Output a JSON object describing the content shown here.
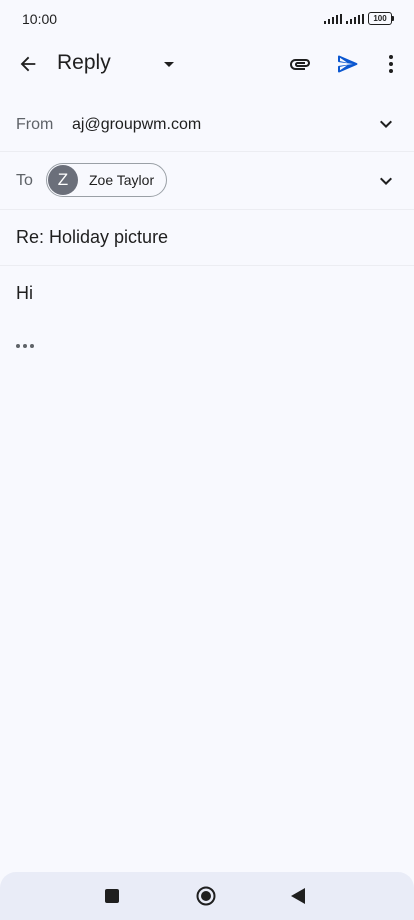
{
  "status_bar": {
    "time": "10:00",
    "battery": "100"
  },
  "app_bar": {
    "title": "Reply",
    "icons": {
      "back": "arrow-back-icon",
      "dropdown": "caret-down-icon",
      "attach": "paperclip-icon",
      "send": "send-icon",
      "more": "more-vert-icon"
    }
  },
  "compose": {
    "from_label": "From",
    "from_value": "aj@groupwm.com",
    "to_label": "To",
    "recipient": {
      "initial": "Z",
      "name": "Zoe Taylor"
    },
    "subject": "Re: Holiday picture",
    "body": "Hi"
  },
  "nav_bar": {
    "icons": [
      "square-recents-icon",
      "circle-home-icon",
      "triangle-back-icon"
    ]
  },
  "colors": {
    "background": "#f8f9fe",
    "send_accent": "#0b57d0",
    "chip_avatar": "#6b6f7a",
    "nav_bar": "#e9ecf7"
  }
}
